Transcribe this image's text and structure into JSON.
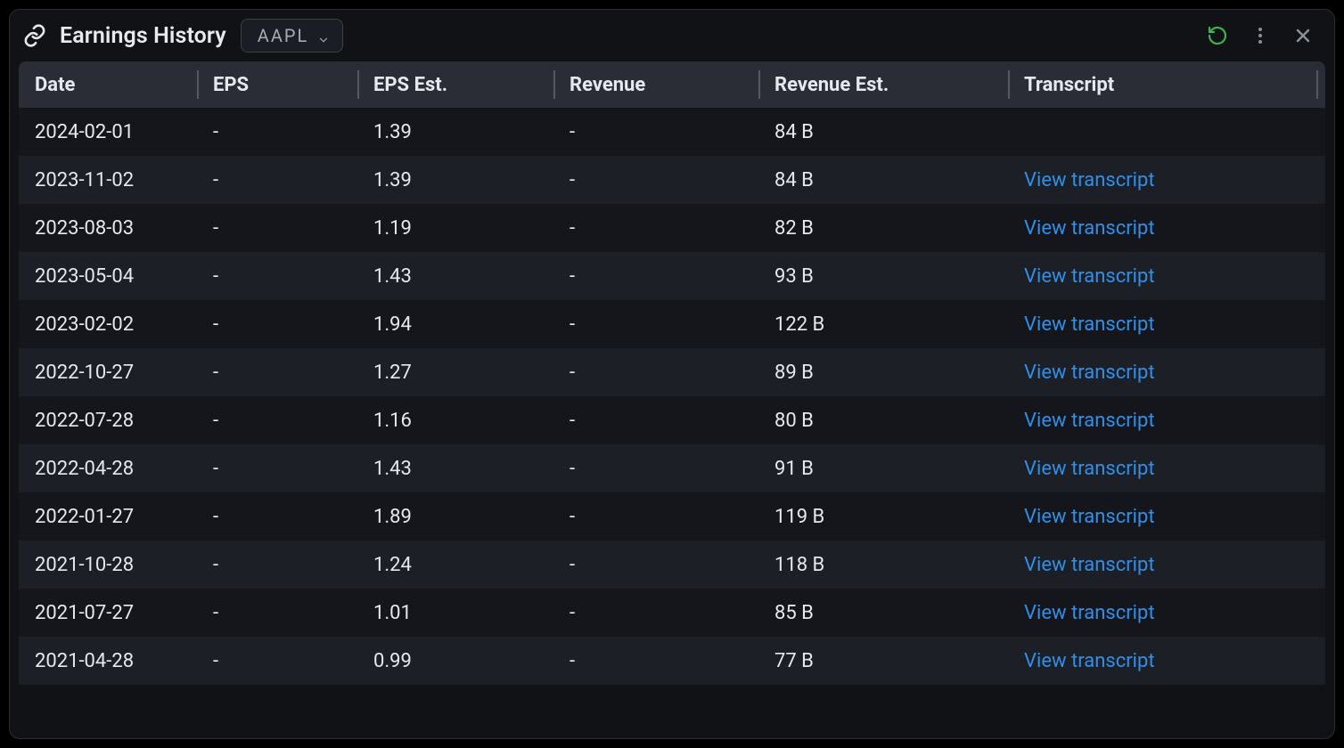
{
  "header": {
    "title": "Earnings History",
    "ticker": "AAPL"
  },
  "columns": [
    "Date",
    "EPS",
    "EPS Est.",
    "Revenue",
    "Revenue Est.",
    "Transcript"
  ],
  "rows": [
    {
      "date": "2024-02-01",
      "eps": "-",
      "eps_est": "1.39",
      "revenue": "-",
      "revenue_est": "84 B",
      "transcript": ""
    },
    {
      "date": "2023-11-02",
      "eps": "-",
      "eps_est": "1.39",
      "revenue": "-",
      "revenue_est": "84 B",
      "transcript": "View transcript"
    },
    {
      "date": "2023-08-03",
      "eps": "-",
      "eps_est": "1.19",
      "revenue": "-",
      "revenue_est": "82 B",
      "transcript": "View transcript"
    },
    {
      "date": "2023-05-04",
      "eps": "-",
      "eps_est": "1.43",
      "revenue": "-",
      "revenue_est": "93 B",
      "transcript": "View transcript"
    },
    {
      "date": "2023-02-02",
      "eps": "-",
      "eps_est": "1.94",
      "revenue": "-",
      "revenue_est": "122 B",
      "transcript": "View transcript"
    },
    {
      "date": "2022-10-27",
      "eps": "-",
      "eps_est": "1.27",
      "revenue": "-",
      "revenue_est": "89 B",
      "transcript": "View transcript"
    },
    {
      "date": "2022-07-28",
      "eps": "-",
      "eps_est": "1.16",
      "revenue": "-",
      "revenue_est": "80 B",
      "transcript": "View transcript"
    },
    {
      "date": "2022-04-28",
      "eps": "-",
      "eps_est": "1.43",
      "revenue": "-",
      "revenue_est": "91 B",
      "transcript": "View transcript"
    },
    {
      "date": "2022-01-27",
      "eps": "-",
      "eps_est": "1.89",
      "revenue": "-",
      "revenue_est": "119 B",
      "transcript": "View transcript"
    },
    {
      "date": "2021-10-28",
      "eps": "-",
      "eps_est": "1.24",
      "revenue": "-",
      "revenue_est": "118 B",
      "transcript": "View transcript"
    },
    {
      "date": "2021-07-27",
      "eps": "-",
      "eps_est": "1.01",
      "revenue": "-",
      "revenue_est": "85 B",
      "transcript": "View transcript"
    },
    {
      "date": "2021-04-28",
      "eps": "-",
      "eps_est": "0.99",
      "revenue": "-",
      "revenue_est": "77 B",
      "transcript": "View transcript"
    }
  ]
}
